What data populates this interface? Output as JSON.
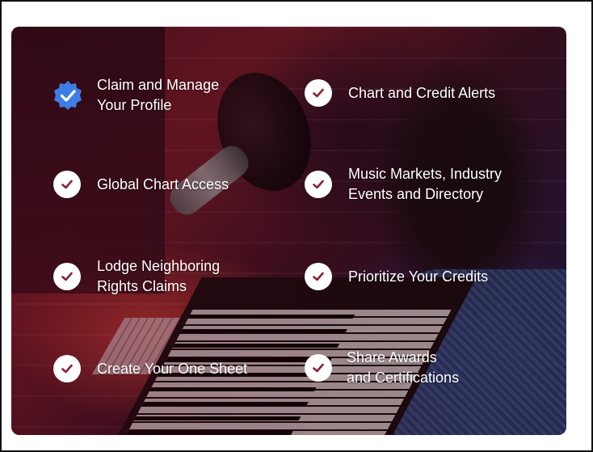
{
  "features": {
    "f1": {
      "line1": "Claim and Manage",
      "line2": "Your Profile",
      "icon": "verified-badge-icon"
    },
    "f2": {
      "line1": "Chart and Credit Alerts",
      "icon": "check-icon"
    },
    "f3": {
      "line1": "Global Chart Access",
      "icon": "check-icon"
    },
    "f4": {
      "line1": "Music Markets, Industry",
      "line2": "Events and Directory",
      "icon": "check-icon"
    },
    "f5": {
      "line1": "Lodge Neighboring",
      "line2": "Rights Claims",
      "icon": "check-icon"
    },
    "f6": {
      "line1": "Prioritize Your Credits",
      "icon": "check-icon"
    },
    "f7": {
      "line1": "Create Your One Sheet",
      "icon": "check-icon"
    },
    "f8": {
      "line1": "Share Awards",
      "line2": "and Certifications",
      "icon": "check-icon"
    }
  },
  "colors": {
    "badge": "#3d7ee6",
    "check_circle": "#ffffff",
    "check_mark": "#8a2233",
    "text": "#ffffff"
  }
}
